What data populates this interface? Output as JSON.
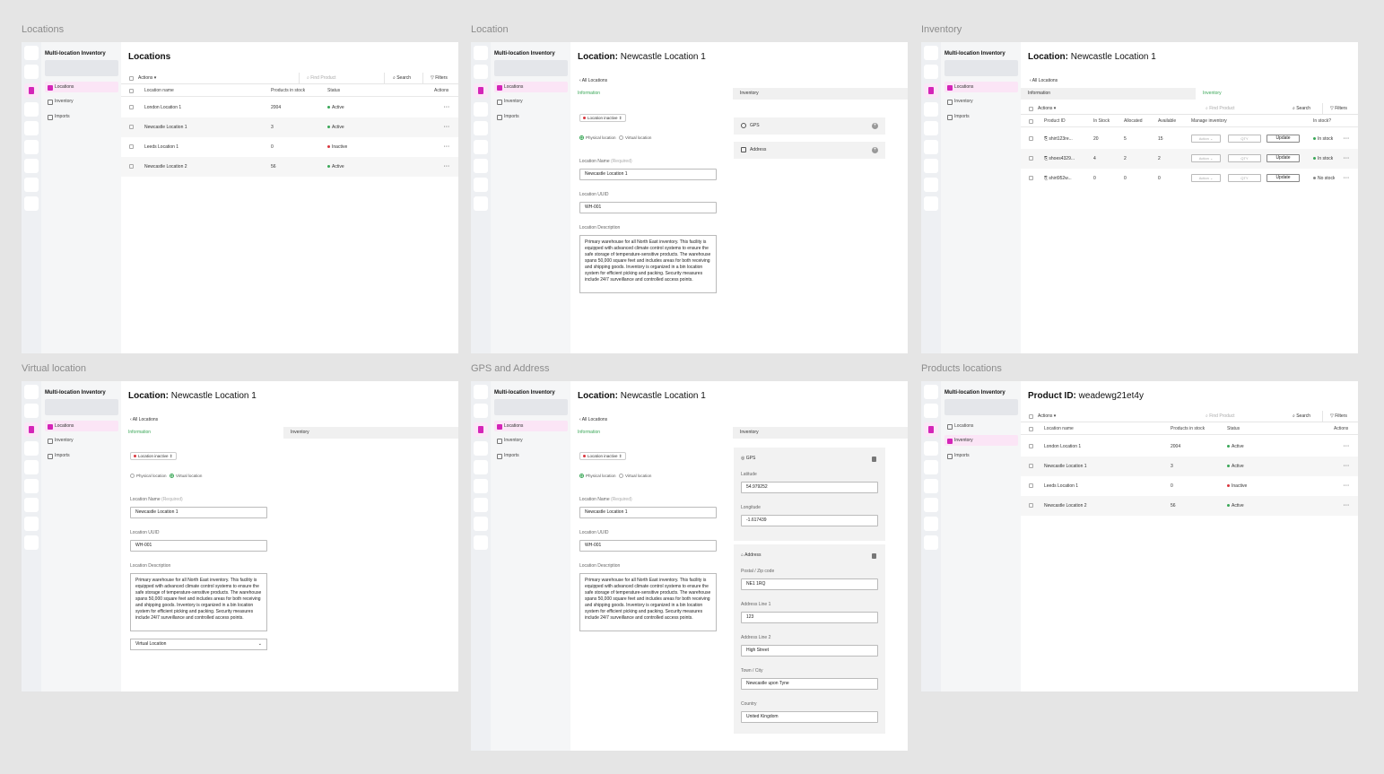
{
  "frames": {
    "f1": "Locations",
    "f2": "Location",
    "f3": "Inventory",
    "f4": "Virtual location",
    "f5": "GPS and Address",
    "f6": "Products locations"
  },
  "app": {
    "name": "Multi-location Inventory"
  },
  "nav": {
    "locations": "Locations",
    "inventory": "Inventory",
    "imports": "Imports"
  },
  "common": {
    "location_prefix": "Location:",
    "location_name": "Newcastle Location 1",
    "all_locations": "All Locations",
    "tab_information": "Information",
    "tab_inventory": "Inventory",
    "status_badge": "Location inactive",
    "radio_physical": "Physical location",
    "radio_virtual": "Virtual location",
    "label_name": "Location Name",
    "label_required": "(Required)",
    "label_uuid": "Location UUID",
    "uuid_value": "WH-001",
    "label_desc": "Location Description",
    "desc_value": "Primary warehouse for all North East inventory. This facility is equipped with advanced climate control systems to ensure the safe storage of temperature-sensitive products. The warehouse spans 50,000 square feet and includes areas for both receiving and shipping goods. Inventory is organized in a bin location system for efficient picking and packing. Security measures include 24/7 surveillance and controlled access points.",
    "gps": "GPS",
    "address": "Address",
    "actions": "Actions",
    "find_product": "Find Product",
    "search": "Search",
    "filters": "Filters"
  },
  "locations_screen": {
    "title": "Locations",
    "columns": [
      "Location name",
      "Products in stock",
      "Status",
      "Actions"
    ],
    "rows": [
      {
        "name": "London Location 1",
        "stock": "2004",
        "status": "Active",
        "color": "#3aa757"
      },
      {
        "name": "Newcastle Location 1",
        "stock": "3",
        "status": "Active",
        "color": "#3aa757"
      },
      {
        "name": "Leeds Location 1",
        "stock": "0",
        "status": "Inactive",
        "color": "#d9363e"
      },
      {
        "name": "Newcastle Location 2",
        "stock": "56",
        "status": "Active",
        "color": "#3aa757"
      }
    ],
    "more": "···"
  },
  "inventory_screen": {
    "columns": [
      "Product ID",
      "In Stock",
      "Allocated",
      "Available",
      "Manage inventory",
      "In stock?"
    ],
    "rows": [
      {
        "id": "shirt123re...",
        "in": "20",
        "alloc": "5",
        "avail": "15",
        "stock": "In stock",
        "color": "#3aa757"
      },
      {
        "id": "shoes4329...",
        "in": "4",
        "alloc": "2",
        "avail": "2",
        "stock": "In stock",
        "color": "#3aa757"
      },
      {
        "id": "shirt952w...",
        "in": "0",
        "alloc": "0",
        "avail": "0",
        "stock": "No stock",
        "color": "#888888"
      }
    ],
    "action_placeholder": "Action",
    "qty_placeholder": "QTY",
    "update": "Update"
  },
  "virtual_screen": {
    "select_value": "Virtual Location"
  },
  "gps_screen": {
    "latitude_label": "Latitude",
    "latitude": "54.979252",
    "longitude_label": "Longitude",
    "longitude": "-1.617439",
    "postal_label": "Postal / Zip code",
    "postal": "NE1 1RQ",
    "addr1_label": "Address Line 1",
    "addr1": "123",
    "addr2_label": "Address Line 2",
    "addr2": "High Street",
    "town_label": "Town / City",
    "town": "Newcastle upon Tyne",
    "country_label": "Country",
    "country": "United Kingdom"
  },
  "products_screen": {
    "title_prefix": "Product ID:",
    "title_value": "weadewg21et4y"
  },
  "colors": {
    "accent": "#d425b8",
    "active": "#3aa757",
    "inactive": "#d9363e"
  }
}
